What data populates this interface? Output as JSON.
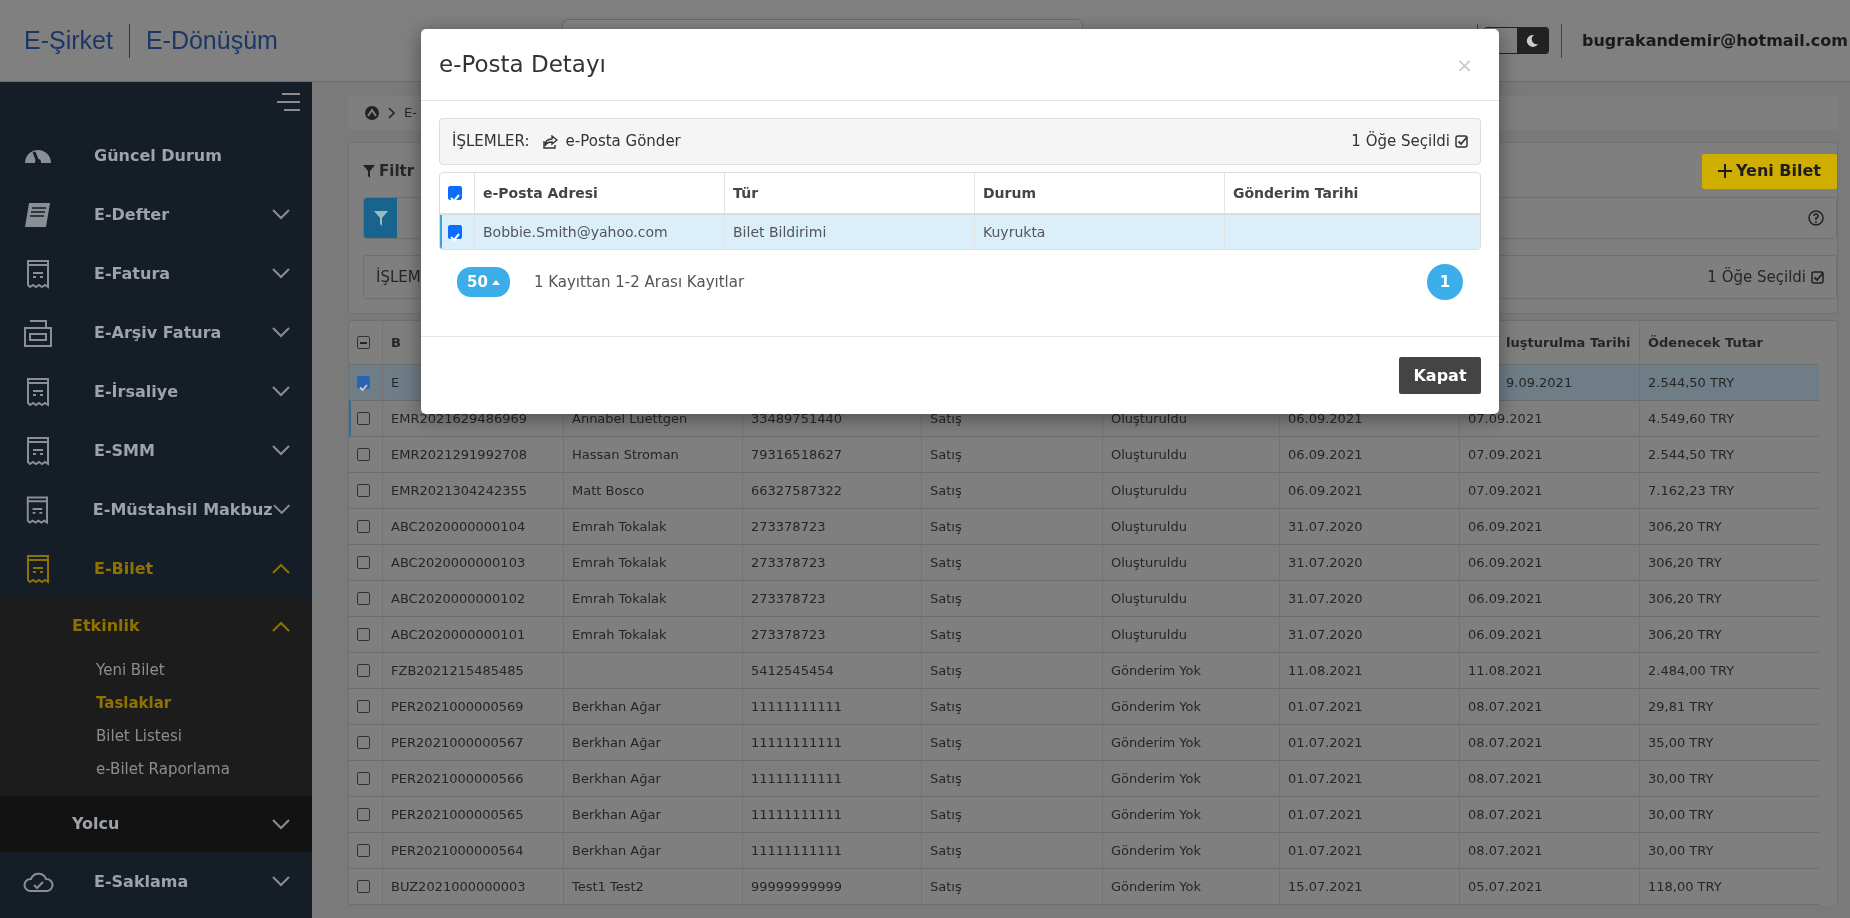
{
  "header": {
    "logo_left": "E-Şirket",
    "logo_right": "E-Dönüşüm",
    "user_email": "bugrakandemir@hotmail.com",
    "dark_mode": false
  },
  "sidebar": {
    "items": [
      {
        "label": "Güncel Durum",
        "kind": "gauge"
      },
      {
        "label": "E-Defter",
        "kind": "book",
        "expanded": false
      },
      {
        "label": "E-Fatura",
        "kind": "receipt",
        "expanded": false
      },
      {
        "label": "E-Arşiv Fatura",
        "kind": "printer",
        "expanded": false
      },
      {
        "label": "E-İrsaliye",
        "kind": "receipt",
        "expanded": false
      },
      {
        "label": "E-SMM",
        "kind": "receipt",
        "expanded": false
      },
      {
        "label": "E-Müstahsil Makbuz",
        "kind": "receipt",
        "expanded": false
      },
      {
        "label": "E-Bilet",
        "kind": "receipt",
        "expanded": true,
        "children": [
          {
            "label": "Etkinlik",
            "expanded": true,
            "children": [
              {
                "label": "Yeni Bilet",
                "selected": false
              },
              {
                "label": "Taslaklar",
                "selected": true
              },
              {
                "label": "Bilet Listesi",
                "selected": false
              },
              {
                "label": "e-Bilet Raporlama",
                "selected": false
              }
            ]
          },
          {
            "label": "Yolcu",
            "expanded": false
          }
        ]
      },
      {
        "label": "E-Saklama",
        "kind": "cloud",
        "expanded": false
      }
    ]
  },
  "breadcrumb": [
    "E-"
  ],
  "filter": {
    "title": "Filtr",
    "new_button": "Yeni Bilet"
  },
  "actions_bar": {
    "label": "İŞLEM",
    "selection": "1 Öğe Seçildi"
  },
  "table": {
    "header_indeterminate": true,
    "columns": [
      {
        "label": "B"
      },
      {},
      {},
      {},
      {},
      {},
      {
        "label": "luşturulma Tarihi"
      },
      {
        "label": "Ödenecek Tutar"
      }
    ],
    "rows": [
      {
        "checked": true,
        "selected": true,
        "cells": [
          "E",
          null,
          null,
          null,
          null,
          null,
          "9.09.2021",
          "2.544,50 TRY"
        ]
      },
      {
        "checked": false,
        "selected": false,
        "cells": [
          "EMR2021629486969",
          "Annabel Luettgen",
          "33489751440",
          "Satış",
          "Oluşturuldu",
          "06.09.2021",
          "07.09.2021",
          "4.549,60 TRY"
        ]
      },
      {
        "checked": false,
        "selected": false,
        "cells": [
          "EMR2021291992708",
          "Hassan Stroman",
          "79316518627",
          "Satış",
          "Oluşturuldu",
          "06.09.2021",
          "07.09.2021",
          "2.544,50 TRY"
        ]
      },
      {
        "checked": false,
        "selected": false,
        "cells": [
          "EMR2021304242355",
          "Matt Bosco",
          "66327587322",
          "Satış",
          "Oluşturuldu",
          "06.09.2021",
          "07.09.2021",
          "7.162,23 TRY"
        ]
      },
      {
        "checked": false,
        "selected": false,
        "cells": [
          "ABC2020000000104",
          "Emrah Tokalak",
          "273378723",
          "Satış",
          "Oluşturuldu",
          "31.07.2020",
          "06.09.2021",
          "306,20 TRY"
        ]
      },
      {
        "checked": false,
        "selected": false,
        "cells": [
          "ABC2020000000103",
          "Emrah Tokalak",
          "273378723",
          "Satış",
          "Oluşturuldu",
          "31.07.2020",
          "06.09.2021",
          "306,20 TRY"
        ]
      },
      {
        "checked": false,
        "selected": false,
        "cells": [
          "ABC2020000000102",
          "Emrah Tokalak",
          "273378723",
          "Satış",
          "Oluşturuldu",
          "31.07.2020",
          "06.09.2021",
          "306,20 TRY"
        ]
      },
      {
        "checked": false,
        "selected": false,
        "cells": [
          "ABC2020000000101",
          "Emrah Tokalak",
          "273378723",
          "Satış",
          "Oluşturuldu",
          "31.07.2020",
          "06.09.2021",
          "306,20 TRY"
        ]
      },
      {
        "checked": false,
        "selected": false,
        "cells": [
          "FZB2021215485485",
          null,
          "5412545454",
          "Satış",
          "Gönderim Yok",
          "11.08.2021",
          "11.08.2021",
          "2.484,00 TRY"
        ]
      },
      {
        "checked": false,
        "selected": false,
        "cells": [
          "PER2021000000569",
          "Berkhan Ağar",
          "11111111111",
          "Satış",
          "Gönderim Yok",
          "01.07.2021",
          "08.07.2021",
          "29,81 TRY"
        ]
      },
      {
        "checked": false,
        "selected": false,
        "cells": [
          "PER2021000000567",
          "Berkhan Ağar",
          "11111111111",
          "Satış",
          "Gönderim Yok",
          "01.07.2021",
          "08.07.2021",
          "35,00 TRY"
        ]
      },
      {
        "checked": false,
        "selected": false,
        "cells": [
          "PER2021000000566",
          "Berkhan Ağar",
          "11111111111",
          "Satış",
          "Gönderim Yok",
          "01.07.2021",
          "08.07.2021",
          "30,00 TRY"
        ]
      },
      {
        "checked": false,
        "selected": false,
        "cells": [
          "PER2021000000565",
          "Berkhan Ağar",
          "11111111111",
          "Satış",
          "Gönderim Yok",
          "01.07.2021",
          "08.07.2021",
          "30,00 TRY"
        ]
      },
      {
        "checked": false,
        "selected": false,
        "cells": [
          "PER2021000000564",
          "Berkhan Ağar",
          "11111111111",
          "Satış",
          "Gönderim Yok",
          "01.07.2021",
          "08.07.2021",
          "30,00 TRY"
        ]
      },
      {
        "checked": false,
        "selected": false,
        "cells": [
          "BUZ2021000000003",
          "Test1 Test2",
          "99999999999",
          "Satış",
          "Gönderim Yok",
          "15.07.2021",
          "05.07.2021",
          "118,00 TRY"
        ]
      }
    ]
  },
  "modal": {
    "title": "e-Posta Detayı",
    "close": "×",
    "toolbar": {
      "label": "İŞLEMLER:",
      "action": "e-Posta Gönder",
      "selection": "1 Öğe Seçildi"
    },
    "table": {
      "header_checked": true,
      "columns": [
        "e-Posta Adresi",
        "Tür",
        "Durum",
        "Gönderim Tarihi"
      ],
      "rows": [
        {
          "checked": true,
          "selected": true,
          "cells": [
            "Bobbie.Smith@yahoo.com",
            "Bilet Bildirimi",
            "Kuyrukta",
            null
          ]
        }
      ]
    },
    "page_size": "50",
    "summary": "1 Kayıttan 1-2 Arası Kayıtlar",
    "pages": [
      {
        "label": "1",
        "selected": true
      }
    ],
    "close_button": "Kapat"
  }
}
